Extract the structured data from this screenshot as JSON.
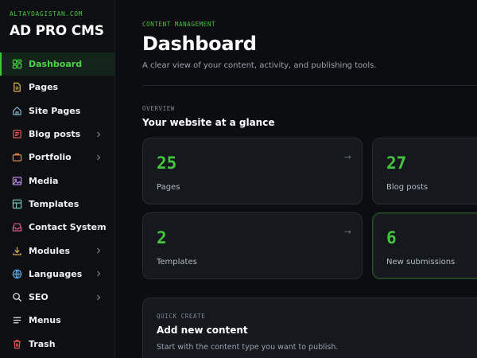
{
  "brand": {
    "domain": "ALTAYDAGISTAN.COM",
    "title": "AD PRO CMS"
  },
  "sidebar": {
    "items": [
      {
        "label": "Dashboard",
        "icon": "dashboard-icon",
        "active": true
      },
      {
        "label": "Pages",
        "icon": "file-icon"
      },
      {
        "label": "Site Pages",
        "icon": "home-icon"
      },
      {
        "label": "Blog posts",
        "icon": "newspaper-icon",
        "has_submenu": true
      },
      {
        "label": "Portfolio",
        "icon": "briefcase-icon",
        "has_submenu": true
      },
      {
        "label": "Media",
        "icon": "image-icon"
      },
      {
        "label": "Templates",
        "icon": "layout-icon"
      },
      {
        "label": "Contact System",
        "icon": "inbox-icon",
        "has_submenu": true
      },
      {
        "label": "Modules",
        "icon": "download-icon",
        "has_submenu": true
      },
      {
        "label": "Languages",
        "icon": "globe-icon",
        "has_submenu": true
      },
      {
        "label": "SEO",
        "icon": "search-icon",
        "has_submenu": true
      },
      {
        "label": "Menus",
        "icon": "menu-icon"
      },
      {
        "label": "Trash",
        "icon": "trash-icon"
      }
    ]
  },
  "header": {
    "eyebrow": "CONTENT MANAGEMENT",
    "title": "Dashboard",
    "subtitle": "A clear view of your content, activity, and publishing tools."
  },
  "overview": {
    "eyebrow": "OVERVIEW",
    "title": "Your website at a glance",
    "cards": [
      {
        "value": "25",
        "label": "Pages",
        "arrow": "→"
      },
      {
        "value": "27",
        "label": "Blog posts"
      },
      {
        "value": "2",
        "label": "Templates",
        "arrow": "→"
      },
      {
        "value": "6",
        "label": "New submissions"
      }
    ]
  },
  "quick_create": {
    "eyebrow": "QUICK CREATE",
    "title": "Add new content",
    "subtitle": "Start with the content type you want to publish."
  },
  "colors": {
    "accent": "#46c441",
    "background": "#0b0d10",
    "card": "#15181d"
  }
}
